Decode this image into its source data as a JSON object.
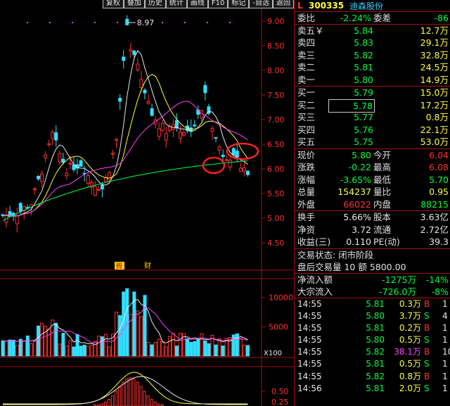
{
  "toolbar": [
    "复权",
    "叠加",
    "历史",
    "统计",
    "画线",
    "F10",
    "标记",
    "-自选",
    "返回"
  ],
  "chart": {
    "high_label": "8.97",
    "price_axis": [
      "9.00",
      "8.50",
      "8.00",
      "7.50",
      "7.00",
      "6.50",
      "6.00",
      "5.50",
      "5.00",
      "4.50"
    ],
    "volume_axis": [
      "10000",
      "5000",
      "X100"
    ],
    "indicator_axis": [
      "0.50",
      "0.25"
    ],
    "markers": [
      "腾",
      "财"
    ],
    "colors": {
      "up": "#ff3030",
      "down": "#30e0ff",
      "ma5": "#e8e8e8",
      "ma10": "#ffff40",
      "ma20": "#ff40ff",
      "ma60": "#00ff40",
      "grid": "#a01010",
      "axis_text": "#ff3030"
    }
  },
  "stock": {
    "flag": "L",
    "code": "300335",
    "name": "迪森股份"
  },
  "ratio": {
    "label1": "委比",
    "value1": "-2.24%",
    "label2": "委差",
    "value2": "-86"
  },
  "asks": [
    {
      "label": "卖五￥",
      "price": "5.84",
      "vol": "12.7万"
    },
    {
      "label": "卖四",
      "price": "5.83",
      "vol": "29.1万"
    },
    {
      "label": "卖三",
      "price": "5.82",
      "vol": "32.8万"
    },
    {
      "label": "卖二",
      "price": "5.81",
      "vol": "24.5万"
    },
    {
      "label": "卖一",
      "price": "5.80",
      "vol": "14.9万"
    }
  ],
  "bids": [
    {
      "label": "买一",
      "price": "5.79",
      "vol": "15.0万"
    },
    {
      "label": "买二",
      "price": "5.78",
      "vol": "17.2万"
    },
    {
      "label": "买三",
      "price": "5.77",
      "vol": "0.8万"
    },
    {
      "label": "买四",
      "price": "5.76",
      "vol": "22.1万"
    },
    {
      "label": "买五",
      "price": "5.75",
      "vol": "53.0万"
    }
  ],
  "stats": [
    {
      "l1": "现价",
      "v1": "5.80",
      "l2": "今开",
      "v2": "6.04"
    },
    {
      "l1": "涨跌",
      "v1": "-0.22",
      "l2": "最高",
      "v2": "6.08"
    },
    {
      "l1": "涨幅",
      "v1": "-3.65%",
      "l2": "最低",
      "v2": "5.70"
    },
    {
      "l1": "总量",
      "v1": "154237",
      "l2": "量比",
      "v2": "0.95"
    },
    {
      "l1": "外盘",
      "v1": "66022",
      "l2": "内盘",
      "v2": "88215"
    }
  ],
  "fundamentals": [
    {
      "l1": "换手",
      "v1": "5.66%",
      "l2": "股本",
      "v2": "3.63亿"
    },
    {
      "l1": "净资",
      "v1": "3.72",
      "l2": "流通",
      "v2": "2.72亿"
    },
    {
      "l1": "收益(三)",
      "v1": "0.110",
      "l2": "PE(动)",
      "v2": "39.3"
    }
  ],
  "trade_status": "交易状态: 闭市阶段",
  "after_hours": "盘后交易量 10 额 5800.00",
  "net_flow": {
    "l": "净流入额",
    "v": "-1275万",
    "p": "-14%"
  },
  "block_flow": {
    "l": "大宗流入",
    "v": "-726.0万",
    "p": "-8%"
  },
  "ticks": [
    {
      "t": "14:55",
      "p": "5.81",
      "v": "0.3万",
      "bs": "B",
      "n": "1"
    },
    {
      "t": "14:55",
      "p": "5.80",
      "v": "3.7万",
      "bs": "S",
      "n": "4"
    },
    {
      "t": "14:55",
      "p": "5.81",
      "v": "0.2万",
      "bs": "B",
      "n": "1"
    },
    {
      "t": "14:55",
      "p": "5.80",
      "v": "0.5万",
      "bs": "S",
      "n": "1"
    },
    {
      "t": "14:55",
      "p": "5.82",
      "v": "38.1万",
      "bs": "B",
      "n": "10"
    },
    {
      "t": "14:55",
      "p": "5.81",
      "v": "0.5万",
      "bs": "S",
      "n": "1"
    },
    {
      "t": "14:55",
      "p": "5.82",
      "v": "0.8万",
      "bs": "B",
      "n": "1"
    },
    {
      "t": "14:56",
      "p": "5.81",
      "v": "2.0万",
      "bs": "S",
      "n": "1"
    }
  ]
}
